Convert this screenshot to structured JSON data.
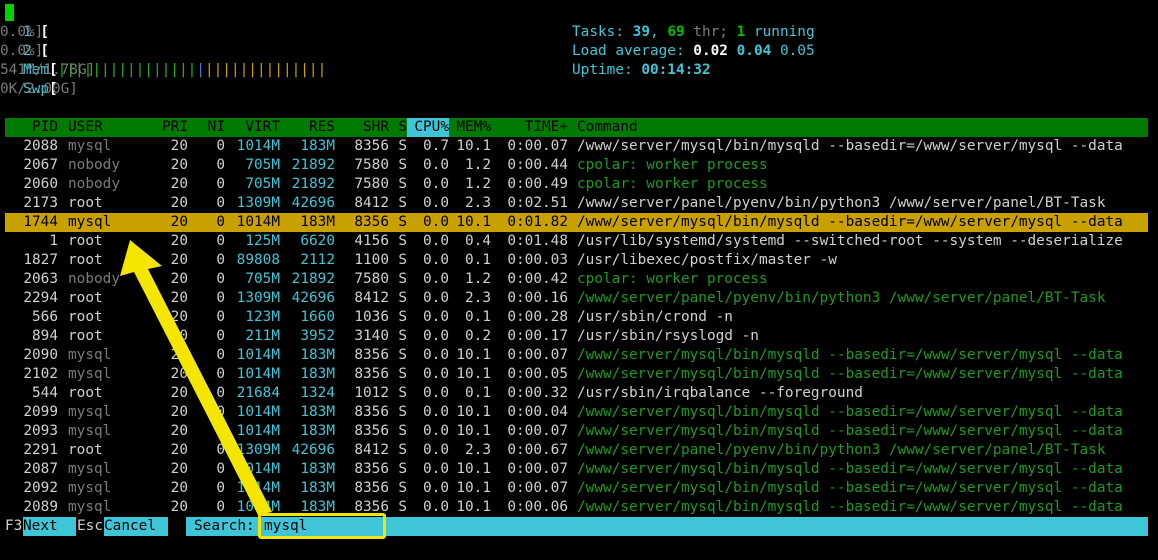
{
  "meters": {
    "cpu1": {
      "label": "1",
      "value": "0.0%]"
    },
    "cpu2": {
      "label": "2",
      "value": "0.0%]"
    },
    "mem": {
      "label": "Mem",
      "bar_green": "||||||||||||||||",
      "bar_blue": "|",
      "bar_yellow": "||||||||||||||",
      "value": "541M/1.78G]"
    },
    "swp": {
      "label": "Swp",
      "value": "0K/2.00G]"
    },
    "open_bracket": "["
  },
  "stats": {
    "tasks_label": "Tasks: ",
    "tasks": "39",
    "sep1": ", ",
    "thr": "69",
    "thr_label": " thr; ",
    "running": "1",
    "running_label": " running",
    "load_label": "Load average: ",
    "load1": "0.02",
    "load5": "0.04",
    "load15": "0.05",
    "uptime_label": "Uptime: ",
    "uptime": "00:14:32"
  },
  "header": {
    "pid": "PID",
    "user": "USER",
    "pri": "PRI",
    "ni": "NI",
    "virt": "VIRT",
    "res": "RES",
    "shr": "SHR",
    "s": "S",
    "cpu": "CPU%",
    "mem": "MEM%",
    "time": "TIME+",
    "command": "Command"
  },
  "processes": [
    {
      "pid": "2088",
      "user": "mysql",
      "pri": "20",
      "ni": "0",
      "virt": "1014M",
      "res": "183M",
      "shr": "8356",
      "s": "S",
      "cpu": "0.7",
      "mem": "10.1",
      "time": "0:00.07",
      "cmd": "/www/server/mysql/bin/mysqld --basedir=/www/server/mysql --data"
    },
    {
      "pid": "2067",
      "user": "nobody",
      "pri": "20",
      "ni": "0",
      "virt": "705M",
      "res": "21892",
      "shr": "7580",
      "s": "S",
      "cpu": "0.0",
      "mem": "1.2",
      "time": "0:00.44",
      "cmd": "cpolar: worker process"
    },
    {
      "pid": "2060",
      "user": "nobody",
      "pri": "20",
      "ni": "0",
      "virt": "705M",
      "res": "21892",
      "shr": "7580",
      "s": "S",
      "cpu": "0.0",
      "mem": "1.2",
      "time": "0:00.49",
      "cmd": "cpolar: worker process"
    },
    {
      "pid": "2173",
      "user": "root",
      "pri": "20",
      "ni": "0",
      "virt": "1309M",
      "res": "42696",
      "shr": "8412",
      "s": "S",
      "cpu": "0.0",
      "mem": "2.3",
      "time": "0:02.51",
      "cmd": "/www/server/panel/pyenv/bin/python3 /www/server/panel/BT-Task"
    },
    {
      "pid": "1744",
      "user": "mysql",
      "pri": "20",
      "ni": "0",
      "virt": "1014M",
      "res": "183M",
      "shr": "8356",
      "s": "S",
      "cpu": "0.0",
      "mem": "10.1",
      "time": "0:01.82",
      "cmd": "/www/server/mysql/bin/mysqld --basedir=/www/server/mysql --data"
    },
    {
      "pid": "1",
      "user": "root",
      "pri": "20",
      "ni": "0",
      "virt": "125M",
      "res": "6620",
      "shr": "4156",
      "s": "S",
      "cpu": "0.0",
      "mem": "0.4",
      "time": "0:01.48",
      "cmd": "/usr/lib/systemd/systemd --switched-root --system --deserialize"
    },
    {
      "pid": "1827",
      "user": "root",
      "pri": "20",
      "ni": "0",
      "virt": "89808",
      "res": "2112",
      "shr": "1100",
      "s": "S",
      "cpu": "0.0",
      "mem": "0.1",
      "time": "0:00.03",
      "cmd": "/usr/libexec/postfix/master -w"
    },
    {
      "pid": "2063",
      "user": "nobody",
      "pri": "20",
      "ni": "0",
      "virt": "705M",
      "res": "21892",
      "shr": "7580",
      "s": "S",
      "cpu": "0.0",
      "mem": "1.2",
      "time": "0:00.42",
      "cmd": "cpolar: worker process"
    },
    {
      "pid": "2294",
      "user": "root",
      "pri": "20",
      "ni": "0",
      "virt": "1309M",
      "res": "42696",
      "shr": "8412",
      "s": "S",
      "cpu": "0.0",
      "mem": "2.3",
      "time": "0:00.16",
      "cmd": "/www/server/panel/pyenv/bin/python3 /www/server/panel/BT-Task"
    },
    {
      "pid": "566",
      "user": "root",
      "pri": "20",
      "ni": "0",
      "virt": "123M",
      "res": "1660",
      "shr": "1036",
      "s": "S",
      "cpu": "0.0",
      "mem": "0.1",
      "time": "0:00.28",
      "cmd": "/usr/sbin/crond -n"
    },
    {
      "pid": "894",
      "user": "root",
      "pri": "20",
      "ni": "0",
      "virt": "211M",
      "res": "3952",
      "shr": "3140",
      "s": "S",
      "cpu": "0.0",
      "mem": "0.2",
      "time": "0:00.17",
      "cmd": "/usr/sbin/rsyslogd -n"
    },
    {
      "pid": "2090",
      "user": "mysql",
      "pri": "20",
      "ni": "0",
      "virt": "1014M",
      "res": "183M",
      "shr": "8356",
      "s": "S",
      "cpu": "0.0",
      "mem": "10.1",
      "time": "0:00.07",
      "cmd": "/www/server/mysql/bin/mysqld --basedir=/www/server/mysql --data"
    },
    {
      "pid": "2102",
      "user": "mysql",
      "pri": "20",
      "ni": "0",
      "virt": "1014M",
      "res": "183M",
      "shr": "8356",
      "s": "S",
      "cpu": "0.0",
      "mem": "10.1",
      "time": "0:00.05",
      "cmd": "/www/server/mysql/bin/mysqld --basedir=/www/server/mysql --data"
    },
    {
      "pid": "544",
      "user": "root",
      "pri": "20",
      "ni": "0",
      "virt": "21684",
      "res": "1324",
      "shr": "1012",
      "s": "S",
      "cpu": "0.0",
      "mem": "0.1",
      "time": "0:00.32",
      "cmd": "/usr/sbin/irqbalance --foreground"
    },
    {
      "pid": "2099",
      "user": "mysql",
      "pri": "20",
      "ni": "0",
      "virt": "1014M",
      "res": "183M",
      "shr": "8356",
      "s": "S",
      "cpu": "0.0",
      "mem": "10.1",
      "time": "0:00.04",
      "cmd": "/www/server/mysql/bin/mysqld --basedir=/www/server/mysql --data"
    },
    {
      "pid": "2093",
      "user": "mysql",
      "pri": "20",
      "ni": "0",
      "virt": "1014M",
      "res": "183M",
      "shr": "8356",
      "s": "S",
      "cpu": "0.0",
      "mem": "10.1",
      "time": "0:00.07",
      "cmd": "/www/server/mysql/bin/mysqld --basedir=/www/server/mysql --data"
    },
    {
      "pid": "2291",
      "user": "root",
      "pri": "20",
      "ni": "0",
      "virt": "1309M",
      "res": "42696",
      "shr": "8412",
      "s": "S",
      "cpu": "0.0",
      "mem": "2.3",
      "time": "0:00.67",
      "cmd": "/www/server/panel/pyenv/bin/python3 /www/server/panel/BT-Task"
    },
    {
      "pid": "2087",
      "user": "mysql",
      "pri": "20",
      "ni": "0",
      "virt": "1014M",
      "res": "183M",
      "shr": "8356",
      "s": "S",
      "cpu": "0.0",
      "mem": "10.1",
      "time": "0:00.07",
      "cmd": "/www/server/mysql/bin/mysqld --basedir=/www/server/mysql --data"
    },
    {
      "pid": "2092",
      "user": "mysql",
      "pri": "20",
      "ni": "0",
      "virt": "1014M",
      "res": "183M",
      "shr": "8356",
      "s": "S",
      "cpu": "0.0",
      "mem": "10.1",
      "time": "0:00.07",
      "cmd": "/www/server/mysql/bin/mysqld --basedir=/www/server/mysql --data"
    },
    {
      "pid": "2089",
      "user": "mysql",
      "pri": "20",
      "ni": "0",
      "virt": "1014M",
      "res": "183M",
      "shr": "8356",
      "s": "S",
      "cpu": "0.0",
      "mem": "10.1",
      "time": "0:00.06",
      "cmd": "/www/server/mysql/bin/mysqld --basedir=/www/server/mysql --data"
    }
  ],
  "selected_index": 4,
  "footer": {
    "f3_key": "F3",
    "next_label": "Next",
    "esc_key": "Esc",
    "cancel_label": "Cancel",
    "search_label": "Search:",
    "search_value": "mysql"
  },
  "colors": {
    "header_bg": "#007a00",
    "selected_row_bg": "#c8a100",
    "accent_cyan": "#3ec5d8",
    "annotation_yellow": "#f5e600"
  }
}
